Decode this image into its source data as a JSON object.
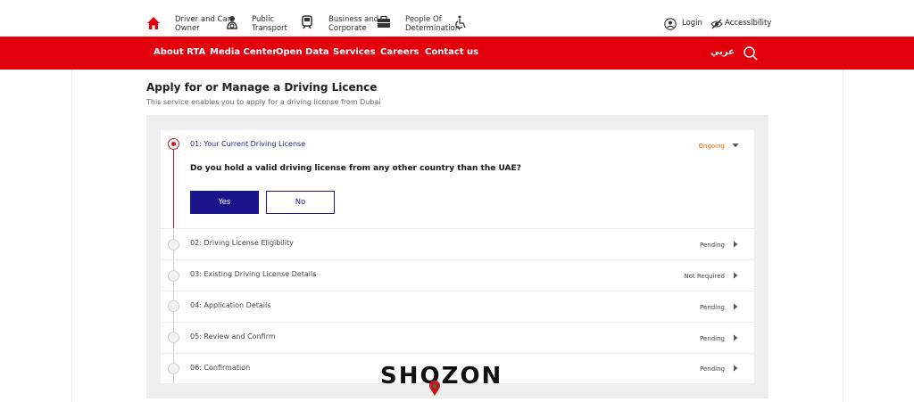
{
  "topbar": {
    "categories": [
      {
        "line1": "Driver and Car",
        "line2": "Owner",
        "icon": "driver-icon"
      },
      {
        "line1": "Public",
        "line2": "Transport",
        "icon": "metro-icon"
      },
      {
        "line1": "Business and",
        "line2": "Corporate",
        "icon": "briefcase-icon"
      },
      {
        "line1": "People Of",
        "line2": "Determination",
        "icon": "wheelchair-icon"
      }
    ],
    "login": "Login",
    "accessibility": "Accessibility"
  },
  "nav": {
    "items": [
      "About RTA",
      "Media Center",
      "Open Data",
      "Services",
      "Careers",
      "Contact us"
    ],
    "language": "عربي"
  },
  "page": {
    "title": "Apply for or Manage a Driving Licence",
    "subtitle": "This service enables you to apply for a driving license from Dubai"
  },
  "steps": [
    {
      "title": "01: Your Current Driving License",
      "status": "Ongoing",
      "active": true
    },
    {
      "title": "02: Driving License Eligibility",
      "status": "Pending"
    },
    {
      "title": "03: Existing Driving License Details",
      "status": "Not Required"
    },
    {
      "title": "04: Application Details",
      "status": "Pending"
    },
    {
      "title": "05: Review and Confirm",
      "status": "Pending"
    },
    {
      "title": "06: Confirmation",
      "status": "Pending"
    }
  ],
  "question": {
    "text": "Do you hold a valid driving license from any other country than the UAE?",
    "yes": "Yes",
    "no": "No"
  },
  "watermark": "SHOZON",
  "colors": {
    "brand_red": "#e2000d",
    "primary_blue": "#1a148a",
    "ongoing_orange": "#e06a00"
  }
}
